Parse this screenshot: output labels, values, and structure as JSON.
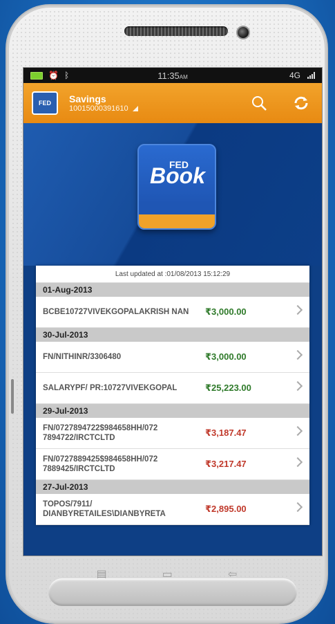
{
  "statusbar": {
    "time": "11:35",
    "time_suffix": "AM",
    "network": "4G"
  },
  "appbar": {
    "account_type": "Savings",
    "account_number": "10015000391610",
    "logo_text": "FED"
  },
  "hero": {
    "logo_small": "FED",
    "logo_big": "Book"
  },
  "transactions": {
    "last_updated": "Last updated at :01/08/2013 15:12:29",
    "groups": [
      {
        "date": "01-Aug-2013",
        "items": [
          {
            "desc": "BCBE10727VIVEKGOPALAKRISH NAN",
            "amount": "₹3,000.00",
            "type": "credit"
          }
        ]
      },
      {
        "date": "30-Jul-2013",
        "items": [
          {
            "desc": "FN/NITHINR/3306480",
            "amount": "₹3,000.00",
            "type": "credit"
          },
          {
            "desc": "SALARYPF/ PR:10727VIVEKGOPAL",
            "amount": "₹25,223.00",
            "type": "credit"
          }
        ]
      },
      {
        "date": "29-Jul-2013",
        "items": [
          {
            "desc": "FN/0727894722$984658HH/072 7894722/IRCTCLTD",
            "amount": "₹3,187.47",
            "type": "debit"
          },
          {
            "desc": "FN/0727889425$984658HH/072 7889425/IRCTCLTD",
            "amount": "₹3,217.47",
            "type": "debit"
          }
        ]
      },
      {
        "date": "27-Jul-2013",
        "items": [
          {
            "desc": "TOPOS/7911/ DIANBYRETAILES\\DIANBYRETA",
            "amount": "₹2,895.00",
            "type": "debit"
          }
        ]
      }
    ]
  },
  "colors": {
    "orange": "#e88a12",
    "blue": "#0e3f85",
    "credit": "#2f7a2a",
    "debit": "#c0392b"
  }
}
